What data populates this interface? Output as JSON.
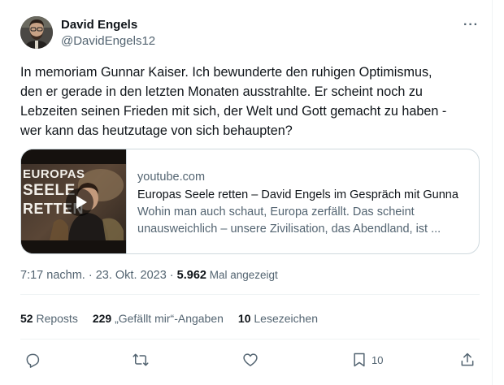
{
  "author": {
    "name": "David Engels",
    "handle": "@DavidEngels12"
  },
  "more_icon": "···",
  "tweet": {
    "lines": [
      "In memoriam Gunnar Kaiser. Ich bewunderte den ruhigen Optimismus,",
      "den er gerade in den letzten Monaten ausstrahlte. Er scheint noch zu",
      "Lebzeiten seinen Frieden mit sich, der Welt und Gott gemacht zu haben -",
      "wer kann das heutzutage von sich behaupten?"
    ]
  },
  "link_card": {
    "thumbnail_text": [
      "EUROPAS",
      "SEELE",
      "RETTEN"
    ],
    "domain": "youtube.com",
    "title": "Europas Seele retten – David Engels im Gespräch mit Gunna",
    "description_lines": [
      "Wohin man auch schaut, Europa zerfällt. Das scheint",
      "unausweichlich – unsere Zivilisation, das Abendland, ist ..."
    ]
  },
  "meta": {
    "time": "7:17 nachm.",
    "separator": " · ",
    "date": "23. Okt. 2023",
    "views": "5.962",
    "views_label": " Mal angezeigt"
  },
  "stats": {
    "reposts_count": "52",
    "reposts_label": " Reposts",
    "likes_count": "229",
    "likes_label": " „Gefällt mir“-Angaben",
    "bookmarks_count": "10",
    "bookmarks_label": " Lesezeichen"
  },
  "actions": {
    "reply_icon": "reply-icon",
    "repost_icon": "repost-icon",
    "like_icon": "heart-icon",
    "bookmark_icon": "bookmark-icon",
    "bookmark_count": "10",
    "share_icon": "share-icon"
  }
}
